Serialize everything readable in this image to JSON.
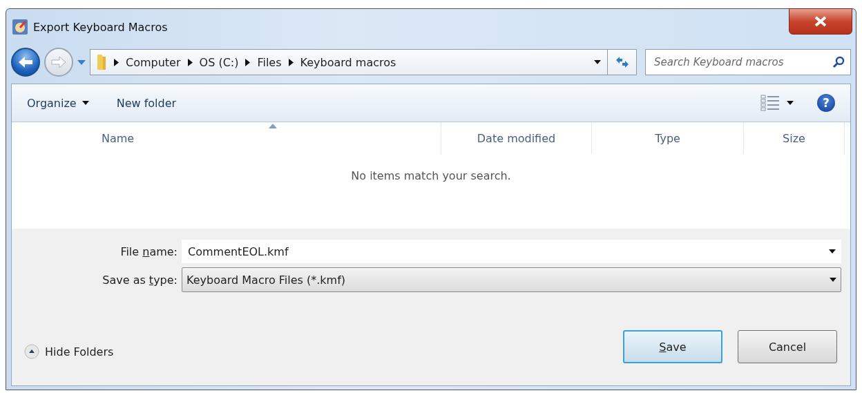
{
  "window": {
    "title": "Export Keyboard Macros"
  },
  "breadcrumb": [
    "Computer",
    "OS (C:)",
    "Files",
    "Keyboard macros"
  ],
  "search": {
    "placeholder": "Search Keyboard macros"
  },
  "toolbar": {
    "organize": "Organize",
    "new_folder": "New folder"
  },
  "table": {
    "columns": [
      {
        "label": "Name",
        "sorted": true
      },
      {
        "label": "Date modified",
        "sorted": false
      },
      {
        "label": "Type",
        "sorted": false
      },
      {
        "label": "Size",
        "sorted": false
      }
    ],
    "empty_message": "No items match your search."
  },
  "help": "?",
  "file_name": {
    "label": {
      "before": "File ",
      "key": "n",
      "after": "ame:"
    },
    "value": "CommentEOL.kmf"
  },
  "save_as_type": {
    "label": {
      "before": "Save as ",
      "key": "t",
      "after": "ype:"
    },
    "value": "Keyboard Macro Files (*.kmf)"
  },
  "hide_folders": "Hide Folders",
  "buttons": [
    {
      "label": {
        "key": "S",
        "after": "ave"
      },
      "kind": "default"
    },
    {
      "label": {
        "before": "Cancel"
      },
      "kind": "normal"
    }
  ]
}
